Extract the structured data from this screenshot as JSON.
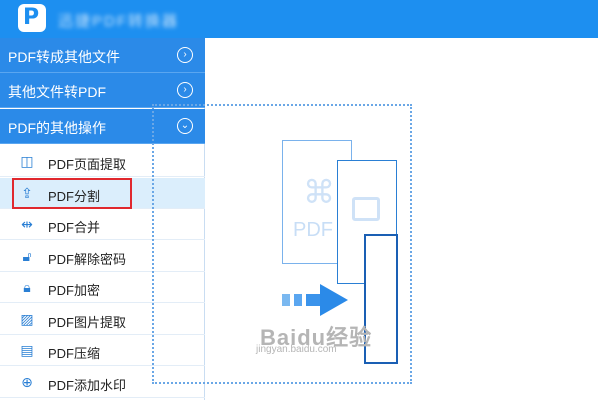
{
  "window": {
    "title": "迅捷PDF转换器"
  },
  "sidebar": {
    "categories": [
      {
        "label": "PDF转成其他文件",
        "chevron": "⊙"
      },
      {
        "label": "其他文件转PDF",
        "chevron": "⊙"
      },
      {
        "label": "PDF的其他操作",
        "chevron": "⊙"
      }
    ],
    "items": [
      {
        "label": "PDF页面提取",
        "icon": "page-extract-icon"
      },
      {
        "label": "PDF分割",
        "icon": "split-icon"
      },
      {
        "label": "PDF合并",
        "icon": "merge-icon"
      },
      {
        "label": "PDF解除密码",
        "icon": "unlock-icon"
      },
      {
        "label": "PDF加密",
        "icon": "lock-icon"
      },
      {
        "label": "PDF图片提取",
        "icon": "image-extract-icon"
      },
      {
        "label": "PDF压缩",
        "icon": "compress-icon"
      },
      {
        "label": "PDF添加水印",
        "icon": "watermark-icon"
      }
    ],
    "active_item": "PDF分割"
  },
  "main": {
    "doc_text": "PDF",
    "watermark": "Baidu经验",
    "watermark_sub": "jingyan.baidu.com"
  },
  "colors": {
    "accent": "#2b8ae8",
    "titlebar": "#1d8ff0",
    "highlight": "#e0282e"
  }
}
